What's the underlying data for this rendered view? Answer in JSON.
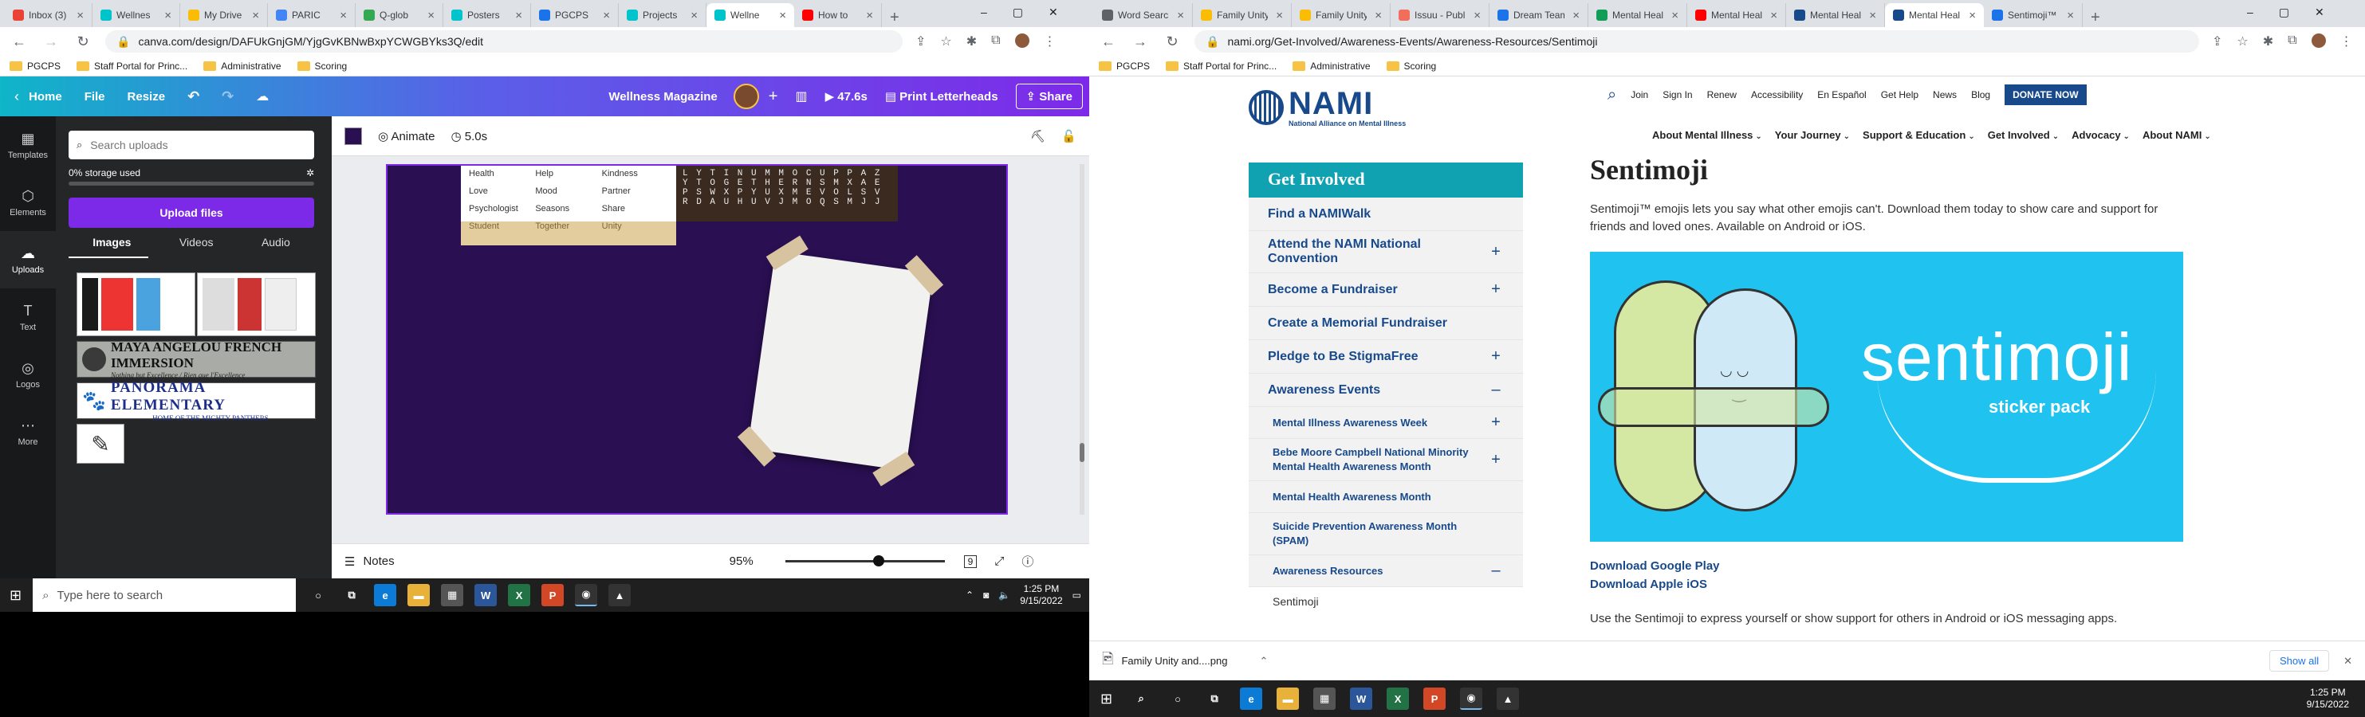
{
  "left_browser": {
    "tabs": [
      {
        "label": "Inbox (3)",
        "color": "#ea4335"
      },
      {
        "label": "Wellnes",
        "color": "#00c4cc"
      },
      {
        "label": "My Drive",
        "color": "#fbbc04"
      },
      {
        "label": "PARIC",
        "color": "#4285f4"
      },
      {
        "label": "Q-glob",
        "color": "#34a853"
      },
      {
        "label": "Posters",
        "color": "#00c4cc"
      },
      {
        "label": "PGCPS",
        "color": "#1a73e8"
      },
      {
        "label": "Projects",
        "color": "#00c4cc"
      },
      {
        "label": "Wellne",
        "color": "#00c4cc",
        "active": true
      },
      {
        "label": "How to",
        "color": "#ff0000"
      }
    ],
    "url": "canva.com/design/DAFUkGnjGM/YjgGvKBNwBxpYCWGBYks3Q/edit",
    "bookmarks": [
      "PGCPS",
      "Staff Portal for Princ...",
      "Administrative",
      "Scoring"
    ]
  },
  "canva": {
    "top": {
      "home": "Home",
      "file": "File",
      "resize": "Resize",
      "title": "Wellness Magazine",
      "timer": "47.6s",
      "print": "Print Letterheads",
      "share": "Share"
    },
    "side": [
      "Templates",
      "Elements",
      "Uploads",
      "Text",
      "Logos",
      "More"
    ],
    "panel": {
      "search_placeholder": "Search uploads",
      "storage": "0% storage used",
      "upload_btn": "Upload files",
      "tabs": [
        "Images",
        "Videos",
        "Audio"
      ],
      "thumb1_title": "MAYA ANGELOU FRENCH IMMERSION",
      "thumb1_sub": "Nothing but Excellence / Rien que l'Excellence",
      "thumb2_title": "PANORAMA ELEMENTARY",
      "thumb2_sub": "HOME OF THE MIGHTY PANTHERS"
    },
    "ctx": {
      "animate": "Animate",
      "duration": "5.0s"
    },
    "words": [
      "Health",
      "Help",
      "Kindness",
      "Love",
      "Mood",
      "Partner",
      "Psychologist",
      "Seasons",
      "Share",
      "Student",
      "Together",
      "Unity"
    ],
    "grid_rows": [
      "L Y T I N U M M O C U P P A Z",
      "Y T O G E T H E R N S M X A E",
      "P S W X P Y U X M E V O L S V",
      "R D A U H U V J M O Q S M J J"
    ],
    "foot": {
      "notes": "Notes",
      "zoom": "95%",
      "page": "9"
    }
  },
  "left_taskbar": {
    "search": "Type here to search",
    "time": "1:25 PM",
    "date": "9/15/2022"
  },
  "right_browser": {
    "tabs": [
      {
        "label": "Word Search",
        "color": "#5f6368"
      },
      {
        "label": "Family Unity",
        "color": "#fbbc04"
      },
      {
        "label": "Family Unity",
        "color": "#fbbc04"
      },
      {
        "label": "Issuu - Publi",
        "color": "#f36d5d"
      },
      {
        "label": "Dream Team",
        "color": "#1a73e8"
      },
      {
        "label": "Mental Heal",
        "color": "#0f9d58"
      },
      {
        "label": "Mental Heal",
        "color": "#ff0000"
      },
      {
        "label": "Mental Heal",
        "color": "#18498b"
      },
      {
        "label": "Mental Heal",
        "color": "#18498b",
        "active": true
      },
      {
        "label": "Sentimoji™ S",
        "color": "#1a73e8"
      }
    ],
    "url": "nami.org/Get-Involved/Awareness-Events/Awareness-Resources/Sentimoji",
    "bookmarks": [
      "PGCPS",
      "Staff Portal for Princ...",
      "Administrative",
      "Scoring"
    ]
  },
  "nami": {
    "logo_text": "NAMI",
    "logo_sub": "National Alliance on Mental Illness",
    "top_links": [
      "Join",
      "Sign In",
      "Renew",
      "Accessibility",
      "En Español",
      "Get Help",
      "News",
      "Blog"
    ],
    "donate": "DONATE NOW",
    "main_nav": [
      "About Mental Illness",
      "Your Journey",
      "Support & Education",
      "Get Involved",
      "Advocacy",
      "About NAMI"
    ],
    "sidebar_header": "Get Involved",
    "sidebar_items": [
      {
        "label": "Find a NAMIWalk",
        "sign": ""
      },
      {
        "label": "Attend the NAMI National Convention",
        "sign": "+"
      },
      {
        "label": "Become a Fundraiser",
        "sign": "+"
      },
      {
        "label": "Create a Memorial Fundraiser",
        "sign": ""
      },
      {
        "label": "Pledge to Be StigmaFree",
        "sign": "+"
      },
      {
        "label": "Awareness Events",
        "sign": "–"
      }
    ],
    "sub_items": [
      {
        "label": "Mental Illness Awareness Week",
        "sign": "+"
      },
      {
        "label": "Bebe Moore Campbell National Minority Mental Health Awareness Month",
        "sign": "+"
      },
      {
        "label": "Mental Health Awareness Month",
        "sign": ""
      },
      {
        "label": "Suicide Prevention Awareness Month (SPAM)",
        "sign": ""
      },
      {
        "label": "Awareness Resources",
        "sign": "–"
      }
    ],
    "sub_sub": "Sentimoji",
    "page_title": "Sentimoji",
    "intro": "Sentimoji™ emojis lets you say what other emojis can't. Download them today to show care and support for friends and loved ones. Available on Android or iOS.",
    "banner_title": "sentimoji",
    "banner_sub": "sticker pack",
    "banner_color": "#20c2ef",
    "dl_google": "Download Google Play",
    "dl_apple": "Download Apple iOS",
    "bottom_text": "Use the Sentimoji to express yourself or show support for others in Android or iOS messaging apps."
  },
  "download_bar": {
    "file": "Family Unity and....png",
    "show_all": "Show all"
  },
  "right_taskbar": {
    "time": "1:25 PM",
    "date": "9/15/2022"
  }
}
